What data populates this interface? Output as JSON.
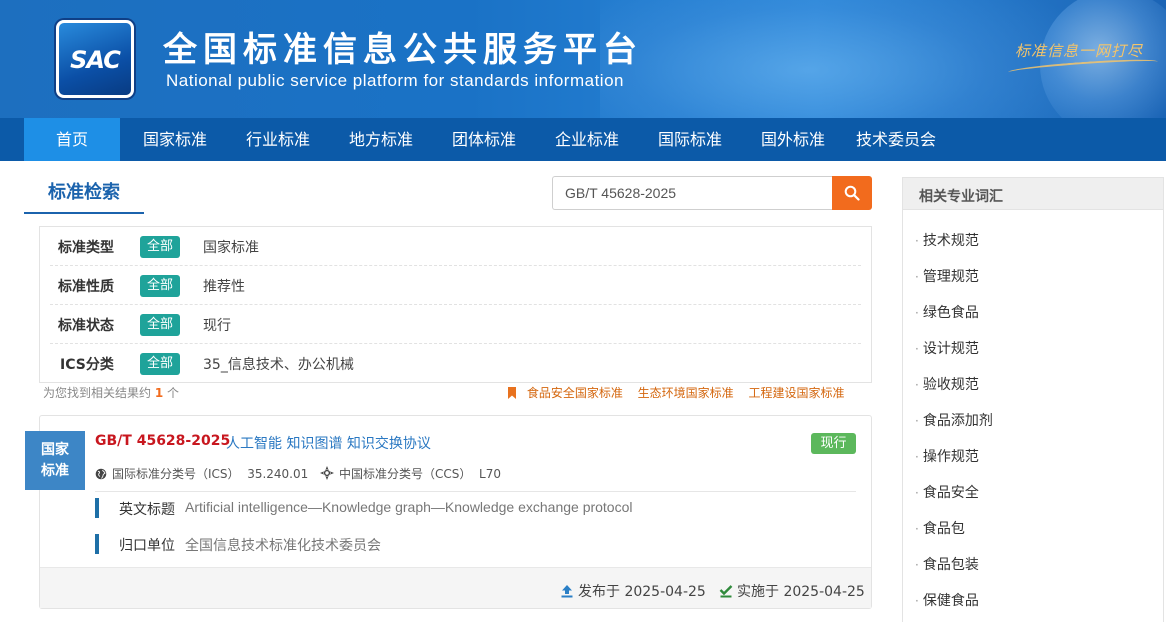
{
  "header": {
    "logo_text": "SAC",
    "title_cn": "全国标准信息公共服务平台",
    "title_en": "National public service platform  for standards information",
    "slogan": "标准信息一网打尽"
  },
  "nav": {
    "items": [
      "首页",
      "国家标准",
      "行业标准",
      "地方标准",
      "团体标准",
      "企业标准",
      "国际标准",
      "国外标准",
      "技术委员会"
    ],
    "active": "首页"
  },
  "search": {
    "section_title": "标准检索",
    "query": "GB/T 45628-2025"
  },
  "filters": [
    {
      "label": "标准类型",
      "tag": "全部",
      "value": "国家标准"
    },
    {
      "label": "标准性质",
      "tag": "全部",
      "value": "推荐性"
    },
    {
      "label": "标准状态",
      "tag": "全部",
      "value": "现行"
    },
    {
      "label": "ICS分类",
      "tag": "全部",
      "value": "35_信息技术、办公机械"
    }
  ],
  "results": {
    "count_prefix": "为您找到相关结果约",
    "count": "1",
    "count_suffix": "个",
    "quick_links": [
      "食品安全国家标准",
      "生态环境国家标准",
      "工程建设国家标准"
    ]
  },
  "card": {
    "type_line1": "国家",
    "type_line2": "标准",
    "code_gb": "GB",
    "code_rest": "/T 45628-2025",
    "name": "人工智能 知识图谱 知识交换协议",
    "status": "现行",
    "ics_label": "国际标准分类号（ICS）",
    "ics_value": "35.240.01",
    "ccs_label": "中国标准分类号（CCS）",
    "ccs_value": "L70",
    "en_title_label": "英文标题",
    "en_title_value": "Artificial intelligence—Knowledge graph—Knowledge exchange protocol",
    "unit_label": "归口单位",
    "unit_value": "全国信息技术标准化技术委员会",
    "published": "发布于 2025-04-25",
    "implemented": "实施于 2025-04-25"
  },
  "sidebar": {
    "title": "相关专业词汇",
    "items": [
      "技术规范",
      "管理规范",
      "绿色食品",
      "设计规范",
      "验收规范",
      "食品添加剂",
      "操作规范",
      "食品安全",
      "食品包",
      "食品包装",
      "保健食品"
    ]
  },
  "colors": {
    "nav_bg": "#0c5aa8",
    "nav_active": "#1e8fe6",
    "accent_orange": "#f26b1d",
    "tag_teal": "#1fa39a",
    "status_green": "#5cb85c",
    "code_red": "#c8171f"
  },
  "icons": {
    "search": "search-icon",
    "globe": "globe-icon",
    "ccs": "crosshair-icon",
    "bookmark": "bookmark-icon",
    "upload": "upload-icon",
    "check": "check-icon"
  }
}
